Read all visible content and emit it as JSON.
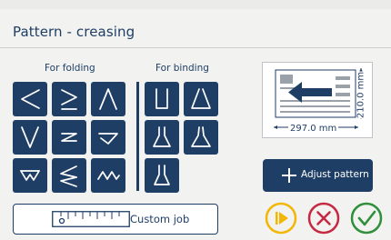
{
  "header": {
    "title": "Pattern - creasing"
  },
  "groups": {
    "folding_label": "For folding",
    "binding_label": "For binding"
  },
  "folding_icons": [
    "left-chevron-fold-icon",
    "double-chevron-fold-icon",
    "tent-fold-icon",
    "valley-fold-icon",
    "z-fold-icon",
    "half-fold-icon",
    "gate-fold-icon",
    "triple-chevron-fold-icon",
    "zigzag-fold-icon"
  ],
  "binding_icons": [
    "u-binding-icon",
    "single-crease-binding-icon",
    "double-crease-binding-icon",
    "wing-binding-icon",
    "trapezoid-binding-icon"
  ],
  "preview": {
    "width_label": "297.0 mm",
    "height_label": "210.0 mm"
  },
  "actions": {
    "custom_job_label": "Custom job",
    "adjust_pattern_label": "Adjust pattern",
    "play_icon": "play-icon",
    "cancel_icon": "cancel-icon",
    "confirm_icon": "confirm-icon"
  },
  "colors": {
    "primary": "#1f3e65",
    "play": "#f2b705",
    "cancel": "#c62a43",
    "confirm": "#2f8f3b"
  }
}
